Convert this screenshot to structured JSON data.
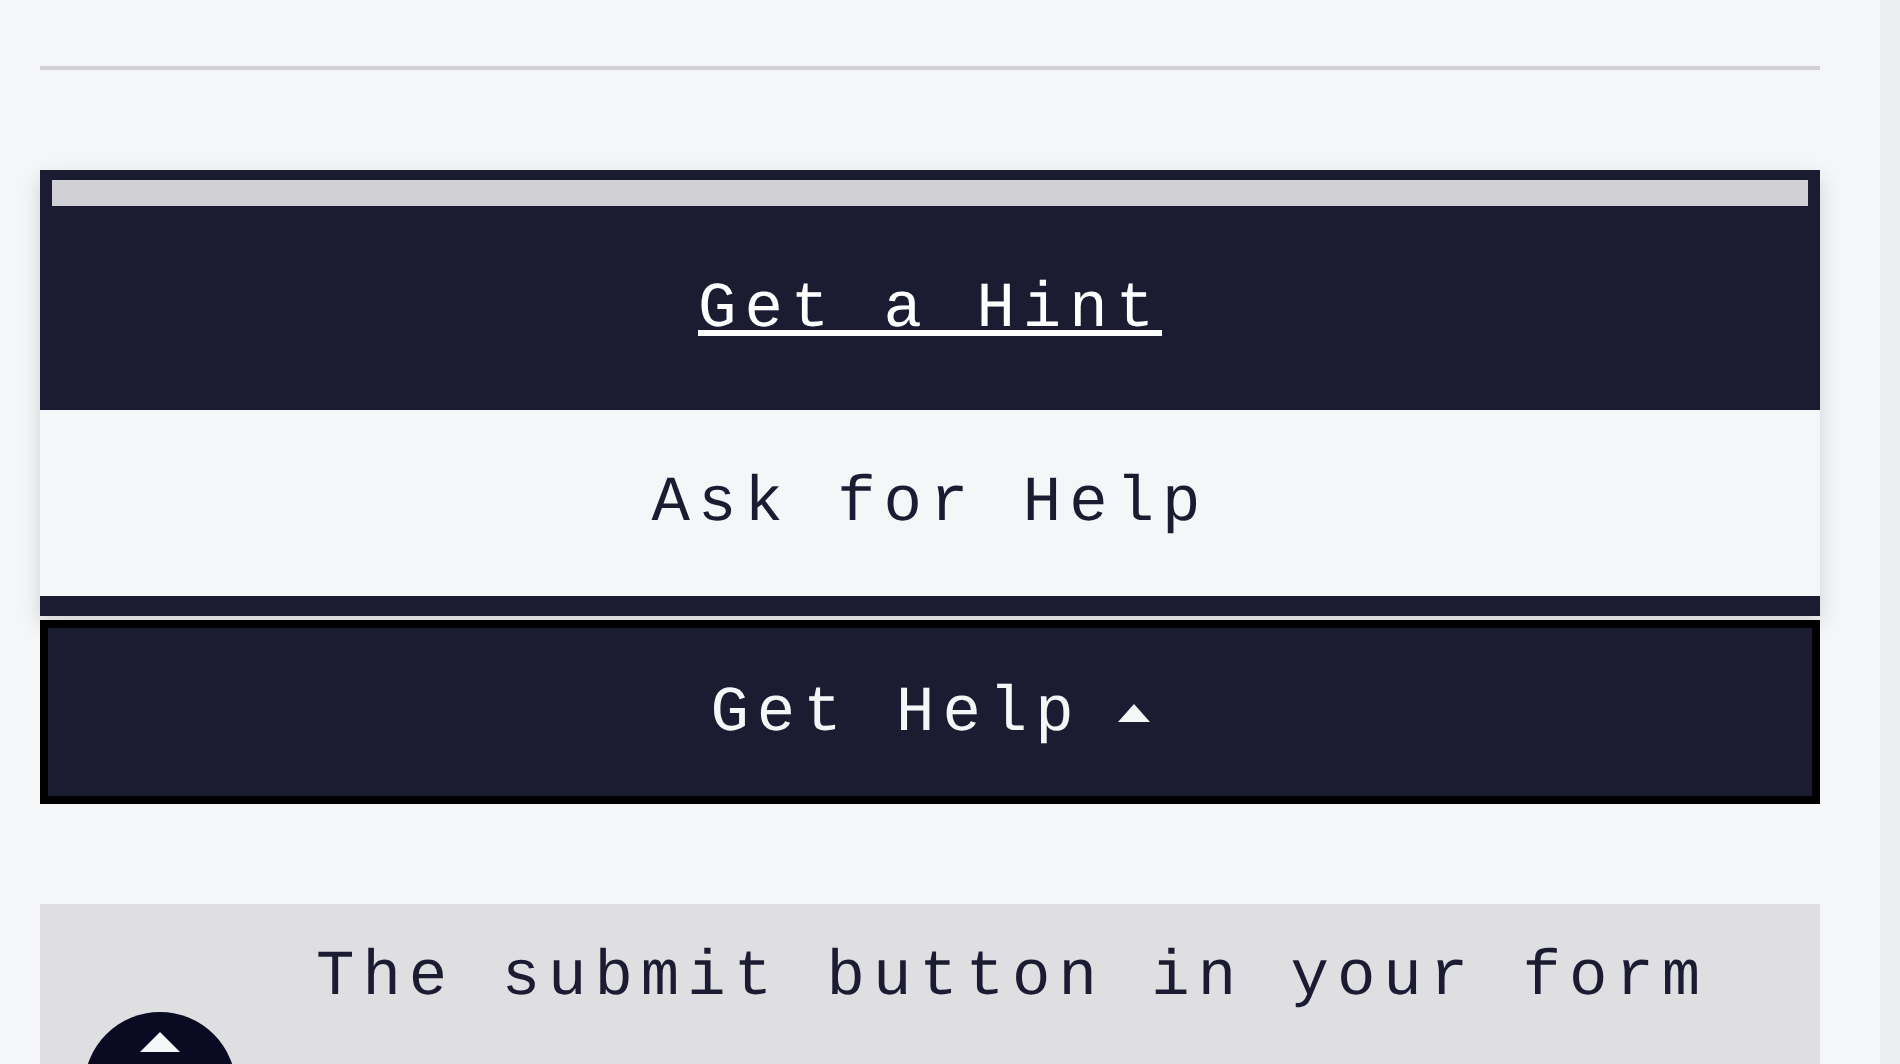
{
  "help_menu": {
    "items": [
      {
        "label": "Get a Hint",
        "selected": true
      },
      {
        "label": "Ask for Help",
        "selected": false
      }
    ]
  },
  "help_button": {
    "label": "Get Help",
    "expanded": true
  },
  "hint": {
    "text": "The submit button in your form"
  }
}
